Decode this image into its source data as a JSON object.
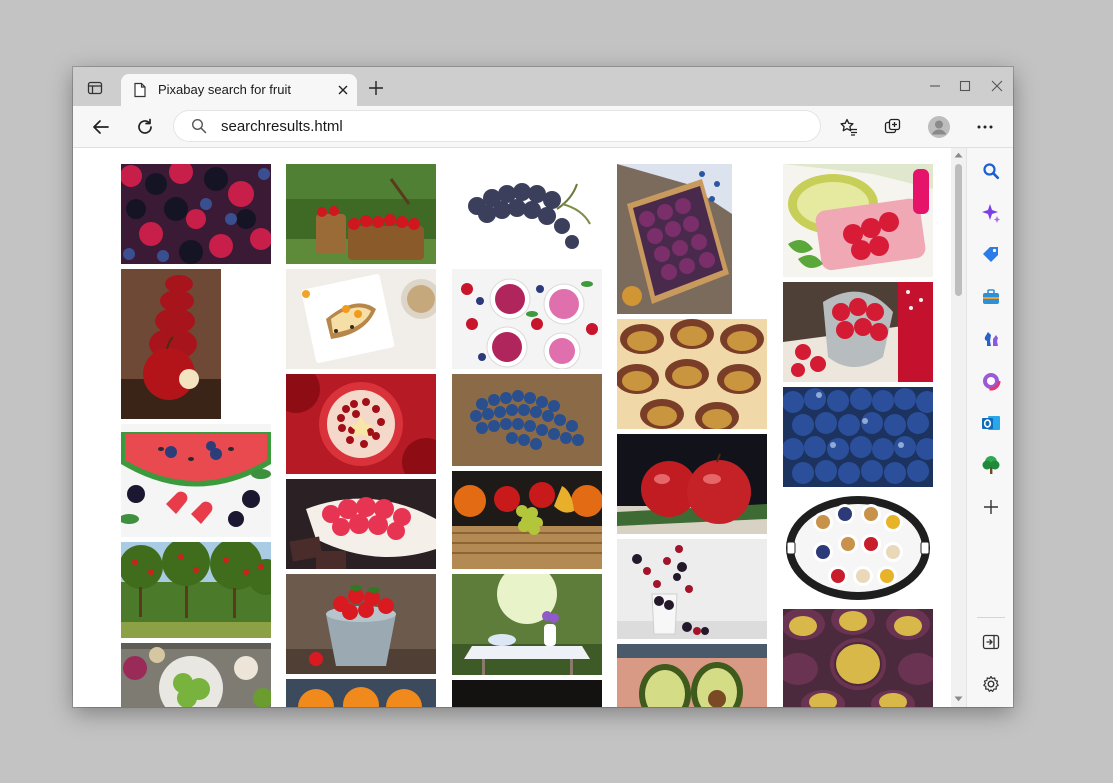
{
  "tab": {
    "title": "Pixabay search for fruit",
    "favicon": "page-icon"
  },
  "toolbar": {
    "address_value": "searchresults.html",
    "icons": [
      "back-arrow-icon",
      "refresh-icon",
      "search-icon",
      "favorites-star-icon",
      "collections-icon",
      "profile-avatar-icon",
      "more-options-icon"
    ]
  },
  "window_controls": [
    "minimize-icon",
    "maximize-icon",
    "close-icon"
  ],
  "sidebar": {
    "icons": [
      "search-icon",
      "copilot-sparkle-icon",
      "shopping-tag-icon",
      "toolbox-icon",
      "games-icon",
      "office-icon",
      "outlook-icon",
      "tree-icon",
      "add-icon",
      "hide-sidebar-icon",
      "settings-icon"
    ]
  },
  "results": {
    "query": "fruit",
    "images": [
      "berries",
      "red apple bitten",
      "watermelon with berries",
      "apple orchard",
      "vegetables and fruit bowls",
      "barrels of apples",
      "breakfast toast with fruit",
      "pomegranate halves",
      "raspberries in bowl",
      "strawberries in bucket",
      "oranges",
      "dark grapes",
      "berry smoothies",
      "blueberries",
      "fruit basket",
      "garden table with flowers",
      "dark image",
      "plums in crate",
      "plum tart",
      "red apples",
      "blackberries in glass",
      "avocado halves",
      "kiwi raspberry popsicles",
      "raspberries and juice",
      "blueberries closeup",
      "seeds and nuts tray",
      "halved plums"
    ]
  },
  "colors": {
    "background": "#c3c3c3",
    "tabbar": "#cecece",
    "toolbar": "#f7f7f7",
    "accent_blue": "#1a73e8"
  }
}
